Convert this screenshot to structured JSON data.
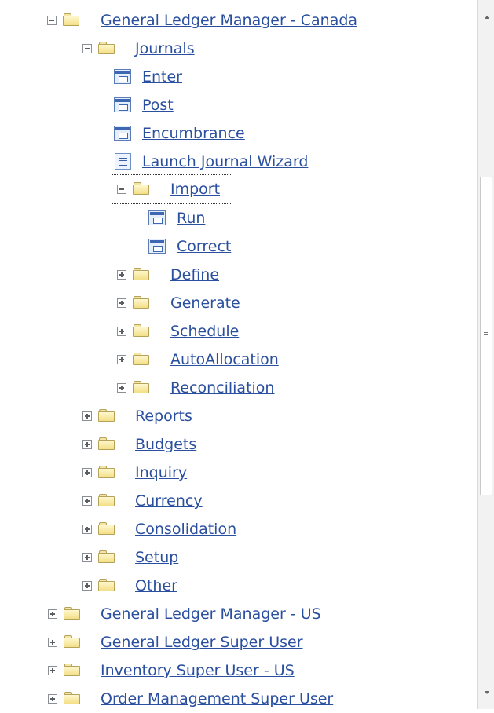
{
  "tree": {
    "items": [
      {
        "label": "General Ledger Manager - Canada",
        "icon": "folder-icon",
        "toggle": "minus"
      },
      {
        "label": "Journals",
        "icon": "folder-icon",
        "toggle": "minus"
      },
      {
        "label": "Enter",
        "icon": "form-icon"
      },
      {
        "label": "Post",
        "icon": "form-icon"
      },
      {
        "label": "Encumbrance",
        "icon": "form-icon"
      },
      {
        "label": "Launch Journal Wizard",
        "icon": "document-list-icon"
      },
      {
        "label": "Import",
        "icon": "folder-icon",
        "toggle": "minus",
        "selected": true
      },
      {
        "label": "Run",
        "icon": "form-icon"
      },
      {
        "label": "Correct",
        "icon": "form-icon"
      },
      {
        "label": "Define",
        "icon": "folder-icon",
        "toggle": "plus"
      },
      {
        "label": "Generate",
        "icon": "folder-icon",
        "toggle": "plus"
      },
      {
        "label": "Schedule",
        "icon": "folder-icon",
        "toggle": "plus"
      },
      {
        "label": "AutoAllocation",
        "icon": "folder-icon",
        "toggle": "plus"
      },
      {
        "label": "Reconciliation",
        "icon": "folder-icon",
        "toggle": "plus"
      },
      {
        "label": "Reports",
        "icon": "folder-icon",
        "toggle": "plus"
      },
      {
        "label": "Budgets",
        "icon": "folder-icon",
        "toggle": "plus"
      },
      {
        "label": "Inquiry",
        "icon": "folder-icon",
        "toggle": "plus"
      },
      {
        "label": "Currency",
        "icon": "folder-icon",
        "toggle": "plus"
      },
      {
        "label": "Consolidation",
        "icon": "folder-icon",
        "toggle": "plus"
      },
      {
        "label": "Setup",
        "icon": "folder-icon",
        "toggle": "plus"
      },
      {
        "label": "Other",
        "icon": "folder-icon",
        "toggle": "plus"
      },
      {
        "label": "General Ledger Manager - US",
        "icon": "folder-icon",
        "toggle": "plus"
      },
      {
        "label": "General Ledger Super User",
        "icon": "folder-icon",
        "toggle": "plus"
      },
      {
        "label": "Inventory Super User - US",
        "icon": "folder-icon",
        "toggle": "plus"
      },
      {
        "label": "Order Management Super User",
        "icon": "folder-icon",
        "toggle": "plus"
      }
    ]
  },
  "scrollbar": {
    "position_fraction": 0.25
  },
  "colors": {
    "link": "#2a4f9f",
    "folder_fill": "#f3df86",
    "form_icon": "#3d66b3",
    "panel_border": "#d7dbe0"
  }
}
